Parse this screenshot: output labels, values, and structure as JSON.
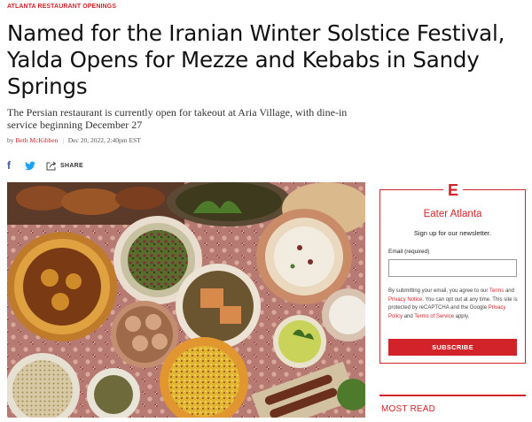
{
  "article": {
    "kicker": "ATLANTA RESTAURANT OPENINGS",
    "headline": "Named for the Iranian Winter Solstice Festival, Yalda Opens for Mezze and Kebabs in Sandy Springs",
    "dek": "The Persian restaurant is currently open for takeout at Aria Village, with dine-in service beginning December 27",
    "byline": {
      "prefix": "by",
      "author": "Beth McKibben",
      "separator": "|",
      "date": "Dec 20, 2022, 2:40pm EST"
    },
    "share": {
      "label": "SHARE",
      "icons": [
        "facebook-icon",
        "twitter-icon",
        "share-icon"
      ]
    },
    "hero_image": "food-spread-photo"
  },
  "newsletter": {
    "logo_letter": "E",
    "brand": "Eater Atlanta",
    "intro": "Sign up for our newsletter.",
    "email_label": "Email",
    "email_required": "(required)",
    "email_value": "",
    "legal_1": "By submitting your email, you agree to our",
    "terms": "Terms",
    "and_1": "and",
    "privacy_notice": "Privacy Notice",
    "legal_2": ". You can opt out at any time. This site is protected by reCAPTCHA and the Google",
    "privacy_policy": "Privacy Policy",
    "and_2": "and",
    "terms_service": "Terms of Service",
    "legal_3": "apply.",
    "subscribe": "SUBSCRIBE"
  },
  "sidebar": {
    "most_read": "MOST READ"
  },
  "colors": {
    "accent": "#d2232a",
    "facebook": "#3b5998",
    "twitter": "#1da1f2"
  }
}
